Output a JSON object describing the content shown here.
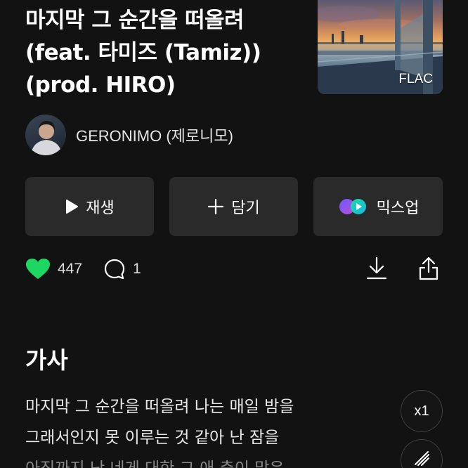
{
  "song": {
    "title_lines": [
      "마지막 그 순간을 떠올려",
      "(feat. 타미즈 (Tamiz))",
      "(prod. HIRO)"
    ],
    "quality_badge": "FLAC"
  },
  "artist": {
    "name": "GERONIMO (제로니모)"
  },
  "actions": {
    "play_label": "재생",
    "add_label": "담기",
    "mixup_label": "믹스업"
  },
  "stats": {
    "likes": "447",
    "comments": "1"
  },
  "lyrics": {
    "heading": "가사",
    "lines": [
      "마지막 그 순간을 떠올려 나는 매일 밤을",
      "그래서인지 못 이루는 것 같아 난 잠을",
      "아직까지 난 네게 대한 그 애 충이 많은"
    ],
    "speed_label": "x1"
  },
  "colors": {
    "like": "#1ed760",
    "background": "#121212",
    "button": "#2a2a2a"
  }
}
